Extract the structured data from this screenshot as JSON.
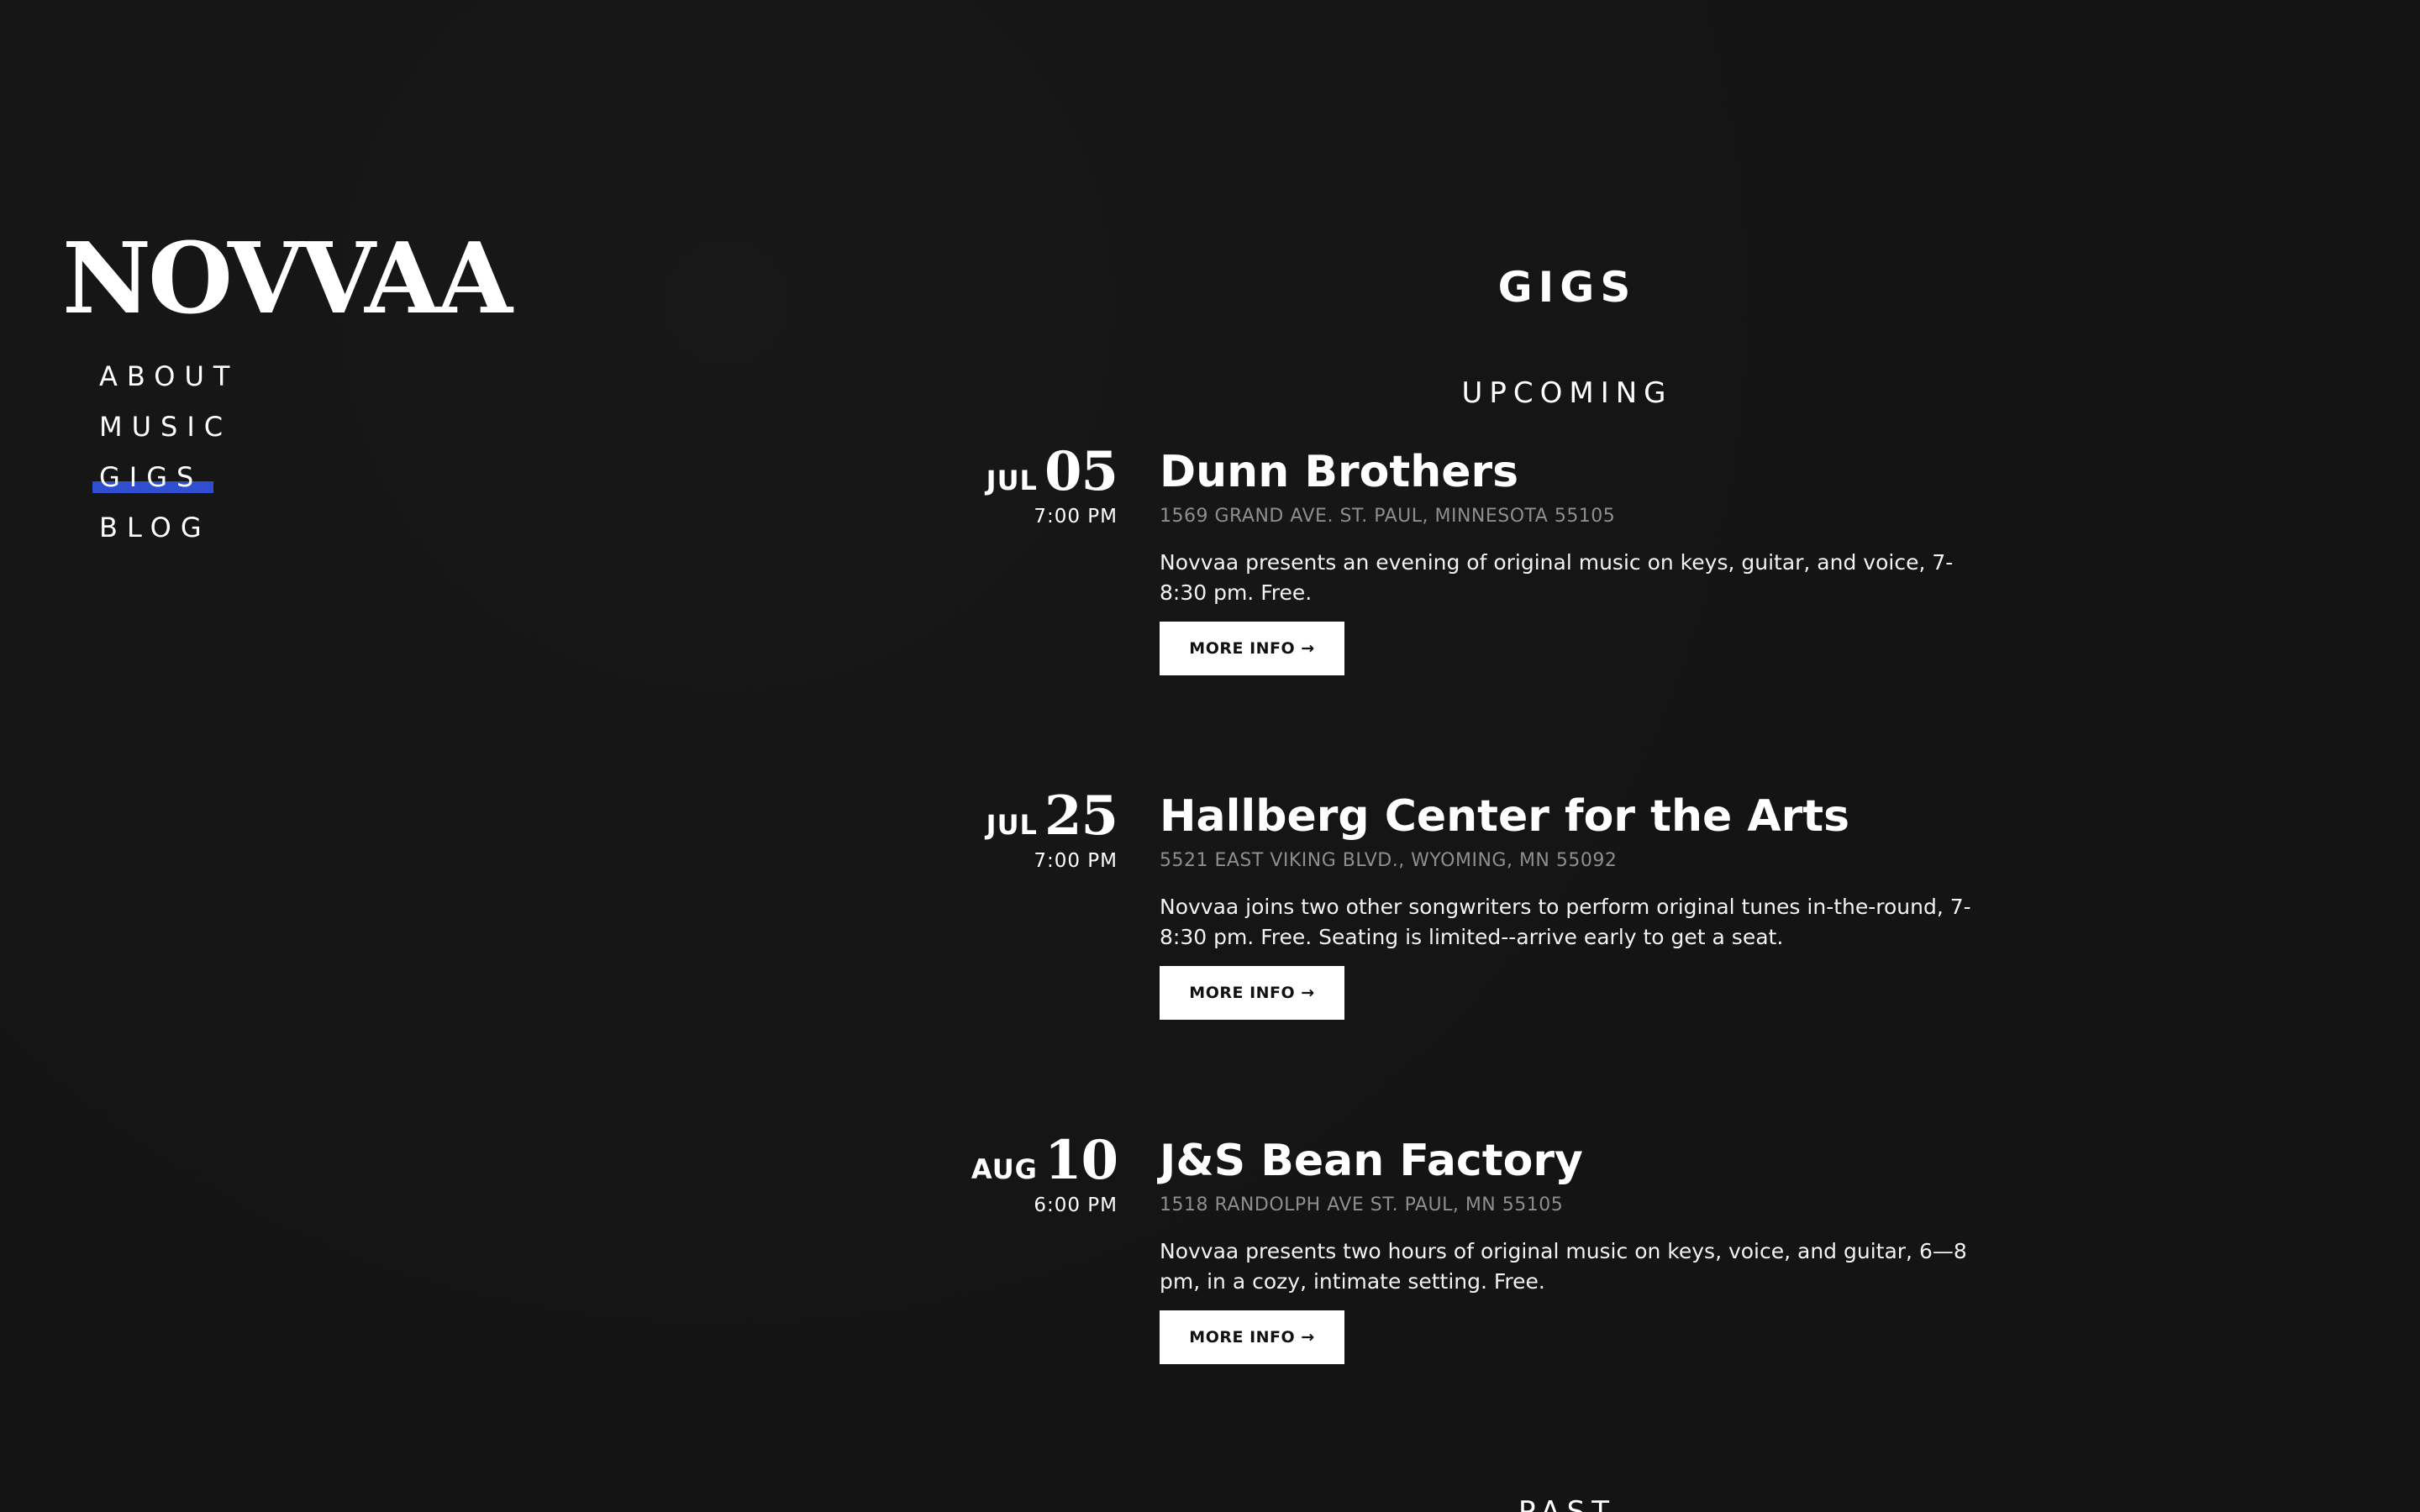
{
  "site": {
    "logo": "NOVVAA"
  },
  "nav": {
    "items": [
      {
        "label": "ABOUT",
        "active": false
      },
      {
        "label": "MUSIC",
        "active": false
      },
      {
        "label": "GIGS",
        "active": true
      },
      {
        "label": "BLOG",
        "active": false
      }
    ],
    "active_color": "#2f4ed0"
  },
  "main": {
    "title": "GIGS",
    "upcoming_label": "UPCOMING",
    "past_label": "PAST",
    "gigs": [
      {
        "month": "JUL",
        "day": "05",
        "time": "7:00 PM",
        "venue": "Dunn Brothers",
        "address": "1569 GRAND AVE. ST. PAUL, MINNESOTA 55105",
        "description": "Novvaa presents an evening of original music on keys, guitar, and voice, 7-8:30 pm. Free.",
        "button": "MORE INFO →"
      },
      {
        "month": "JUL",
        "day": "25",
        "time": "7:00 PM",
        "venue": "Hallberg Center for the Arts",
        "address": "5521 EAST VIKING BLVD., WYOMING, MN 55092",
        "description": "Novvaa joins two other songwriters to perform original tunes in-the-round, 7-8:30 pm. Free. Seating is limited--arrive early to get a seat.",
        "button": "MORE INFO →"
      },
      {
        "month": "AUG",
        "day": "10",
        "time": "6:00 PM",
        "venue": "J&S Bean Factory",
        "address": "1518 RANDOLPH AVE ST. PAUL, MN 55105",
        "description": "Novvaa presents two hours of original music on keys, voice, and guitar, 6—8 pm, in a cozy, intimate setting. Free.",
        "button": "MORE INFO →"
      }
    ]
  },
  "colors": {
    "background": "#141414",
    "text": "#ffffff",
    "muted": "#8e8e8e",
    "button_bg": "#ffffff",
    "button_text": "#111111"
  }
}
